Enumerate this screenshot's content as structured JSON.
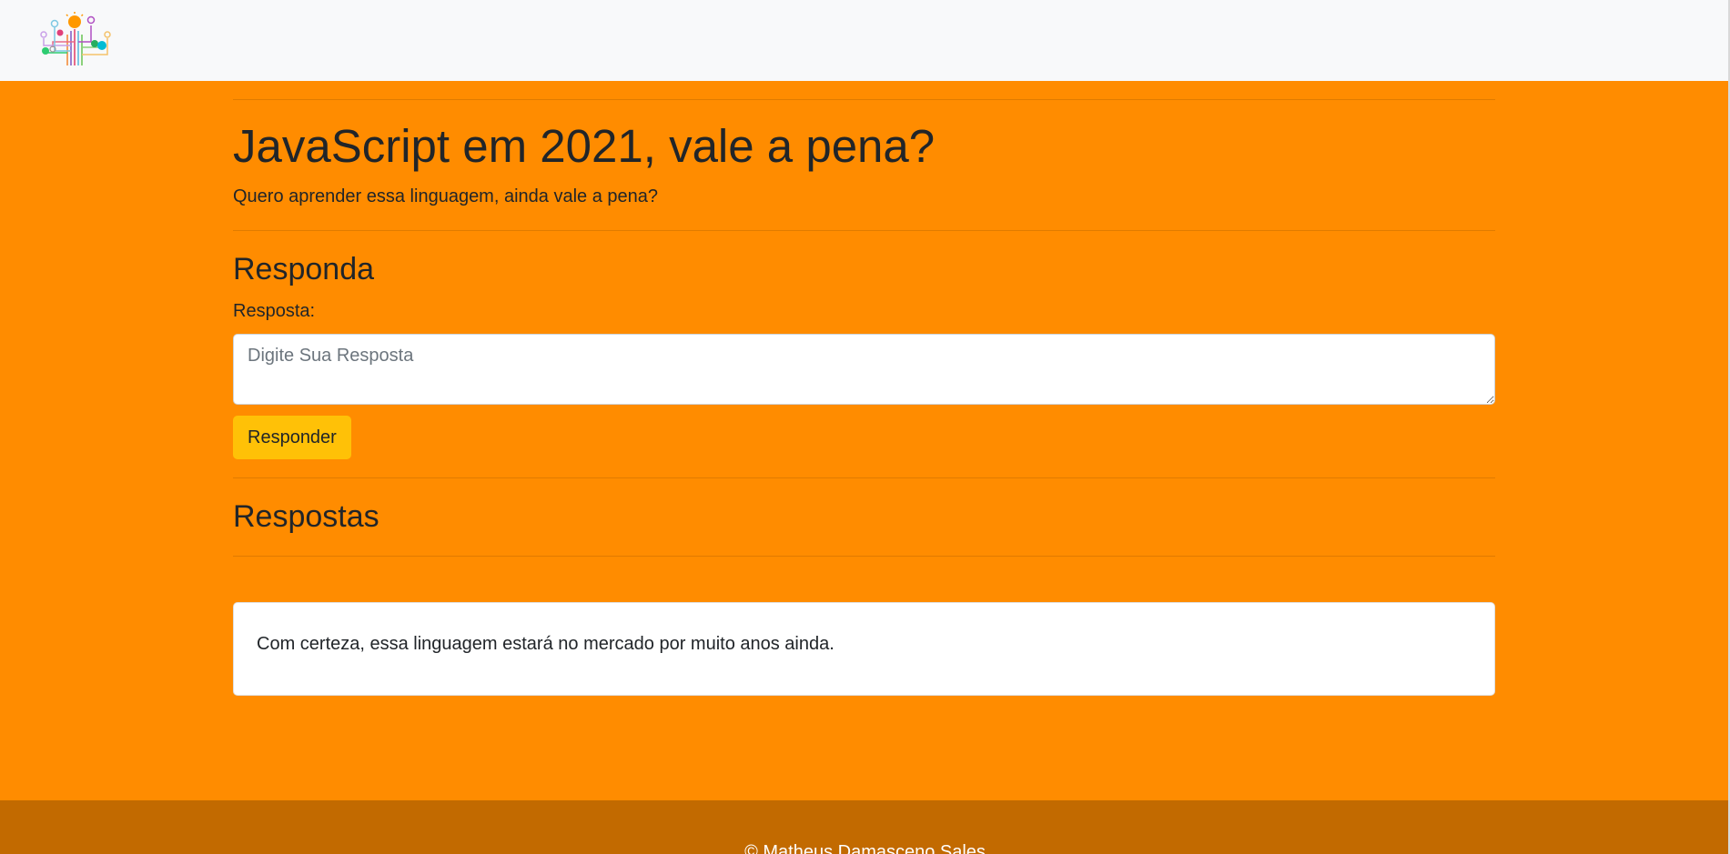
{
  "navbar": {
    "logo_icon": "lightbulb-circuit-logo-icon"
  },
  "question": {
    "title": "JavaScript em 2021, vale a pena?",
    "description": "Quero aprender essa linguagem, ainda vale a pena?"
  },
  "answer_form": {
    "heading": "Responda",
    "label": "Resposta:",
    "placeholder": "Digite Sua Resposta",
    "value": "",
    "submit_label": "Responder"
  },
  "answers": {
    "heading": "Respostas",
    "items": [
      {
        "text": "Com certeza, essa linguagem estará no mercado por muito anos ainda."
      }
    ]
  },
  "footer": {
    "text": "© Matheus Damasceno Sales"
  },
  "colors": {
    "background": "#ff8c00",
    "navbar": "#f8f9fa",
    "button": "#ffc107",
    "footer": "#c26a00"
  }
}
